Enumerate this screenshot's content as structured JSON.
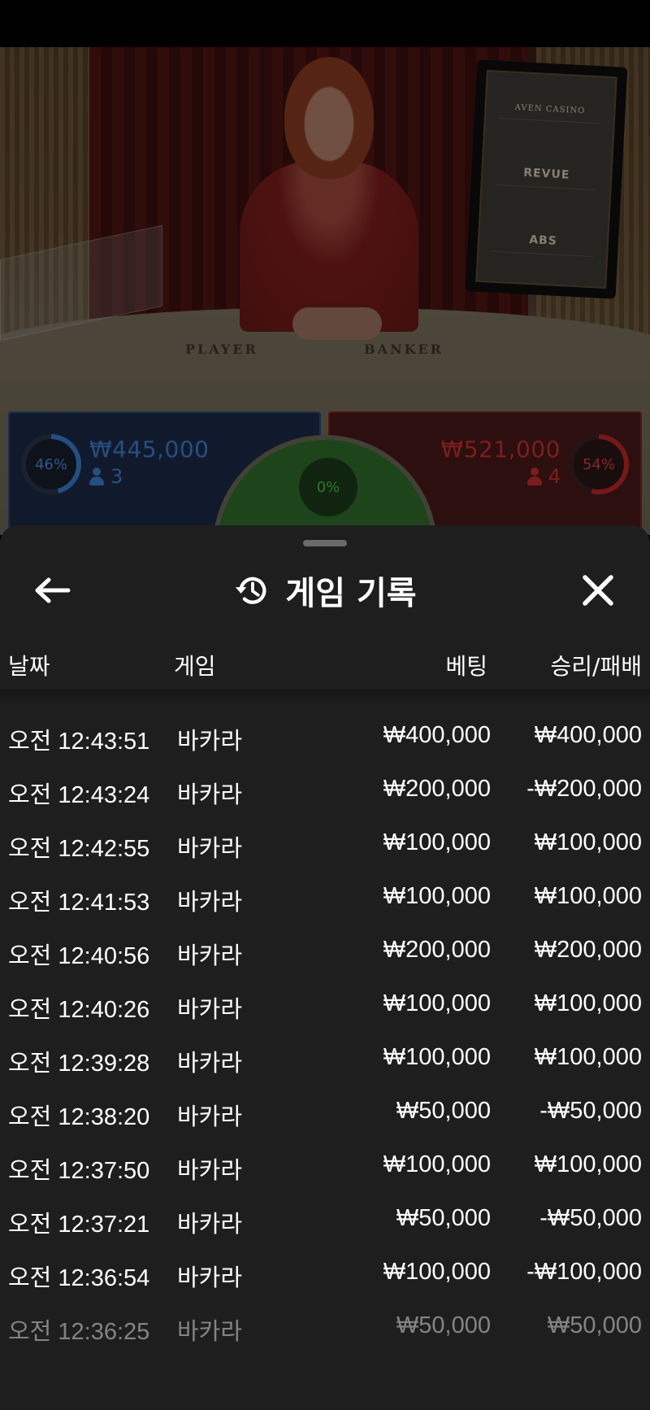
{
  "video": {
    "table_labels": {
      "player": "PLAYER",
      "banker": "BANKER"
    },
    "sponsors": [
      "AVEN CASINO",
      "REVUE",
      "ABS"
    ]
  },
  "bets": {
    "player": {
      "percent_label": "46%",
      "percent": 46,
      "amount": "₩445,000",
      "count": "3",
      "color": "#3f7fcf"
    },
    "tie": {
      "percent_label": "0%",
      "percent": 0,
      "color": "#4ec04a"
    },
    "banker": {
      "percent_label": "54%",
      "percent": 54,
      "amount": "₩521,000",
      "count": "4",
      "color": "#c83030"
    }
  },
  "sheet": {
    "title": "게임 기록",
    "icons": {
      "back": "arrow-left-icon",
      "history": "history-icon",
      "close": "close-icon"
    },
    "columns": {
      "date": "날짜",
      "game": "게임",
      "bet": "베팅",
      "win_loss": "승리/패배"
    },
    "rows": [
      {
        "date": "오전 12:43:51",
        "game": "바카라",
        "bet": "₩400,000",
        "win_loss": "₩400,000"
      },
      {
        "date": "오전 12:43:24",
        "game": "바카라",
        "bet": "₩200,000",
        "win_loss": "-₩200,000"
      },
      {
        "date": "오전 12:42:55",
        "game": "바카라",
        "bet": "₩100,000",
        "win_loss": "₩100,000"
      },
      {
        "date": "오전 12:41:53",
        "game": "바카라",
        "bet": "₩100,000",
        "win_loss": "₩100,000"
      },
      {
        "date": "오전 12:40:56",
        "game": "바카라",
        "bet": "₩200,000",
        "win_loss": "₩200,000"
      },
      {
        "date": "오전 12:40:26",
        "game": "바카라",
        "bet": "₩100,000",
        "win_loss": "₩100,000"
      },
      {
        "date": "오전 12:39:28",
        "game": "바카라",
        "bet": "₩100,000",
        "win_loss": "₩100,000"
      },
      {
        "date": "오전 12:38:20",
        "game": "바카라",
        "bet": "₩50,000",
        "win_loss": "-₩50,000"
      },
      {
        "date": "오전 12:37:50",
        "game": "바카라",
        "bet": "₩100,000",
        "win_loss": "₩100,000"
      },
      {
        "date": "오전 12:37:21",
        "game": "바카라",
        "bet": "₩50,000",
        "win_loss": "-₩50,000"
      },
      {
        "date": "오전 12:36:54",
        "game": "바카라",
        "bet": "₩100,000",
        "win_loss": "-₩100,000"
      },
      {
        "date": "오전 12:36:25",
        "game": "바카라",
        "bet": "₩50,000",
        "win_loss": "₩50,000"
      }
    ]
  }
}
